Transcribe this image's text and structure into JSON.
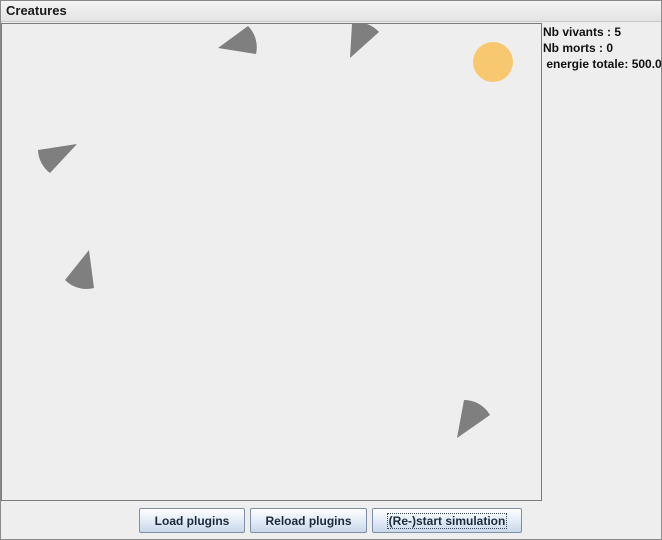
{
  "window": {
    "title": "Creatures"
  },
  "stats": {
    "alive": "Nb vivants : 5",
    "dead": "Nb morts : 0",
    "energy": " energie totale: 500.0"
  },
  "buttons": {
    "load": "Load plugins",
    "reload": "Reload plugins",
    "restart": "(Re-)start simulation"
  },
  "colors": {
    "creature": "#7f7f7f",
    "energy_source": "#f8c870",
    "canvas_bg": "#eeeeee"
  }
}
